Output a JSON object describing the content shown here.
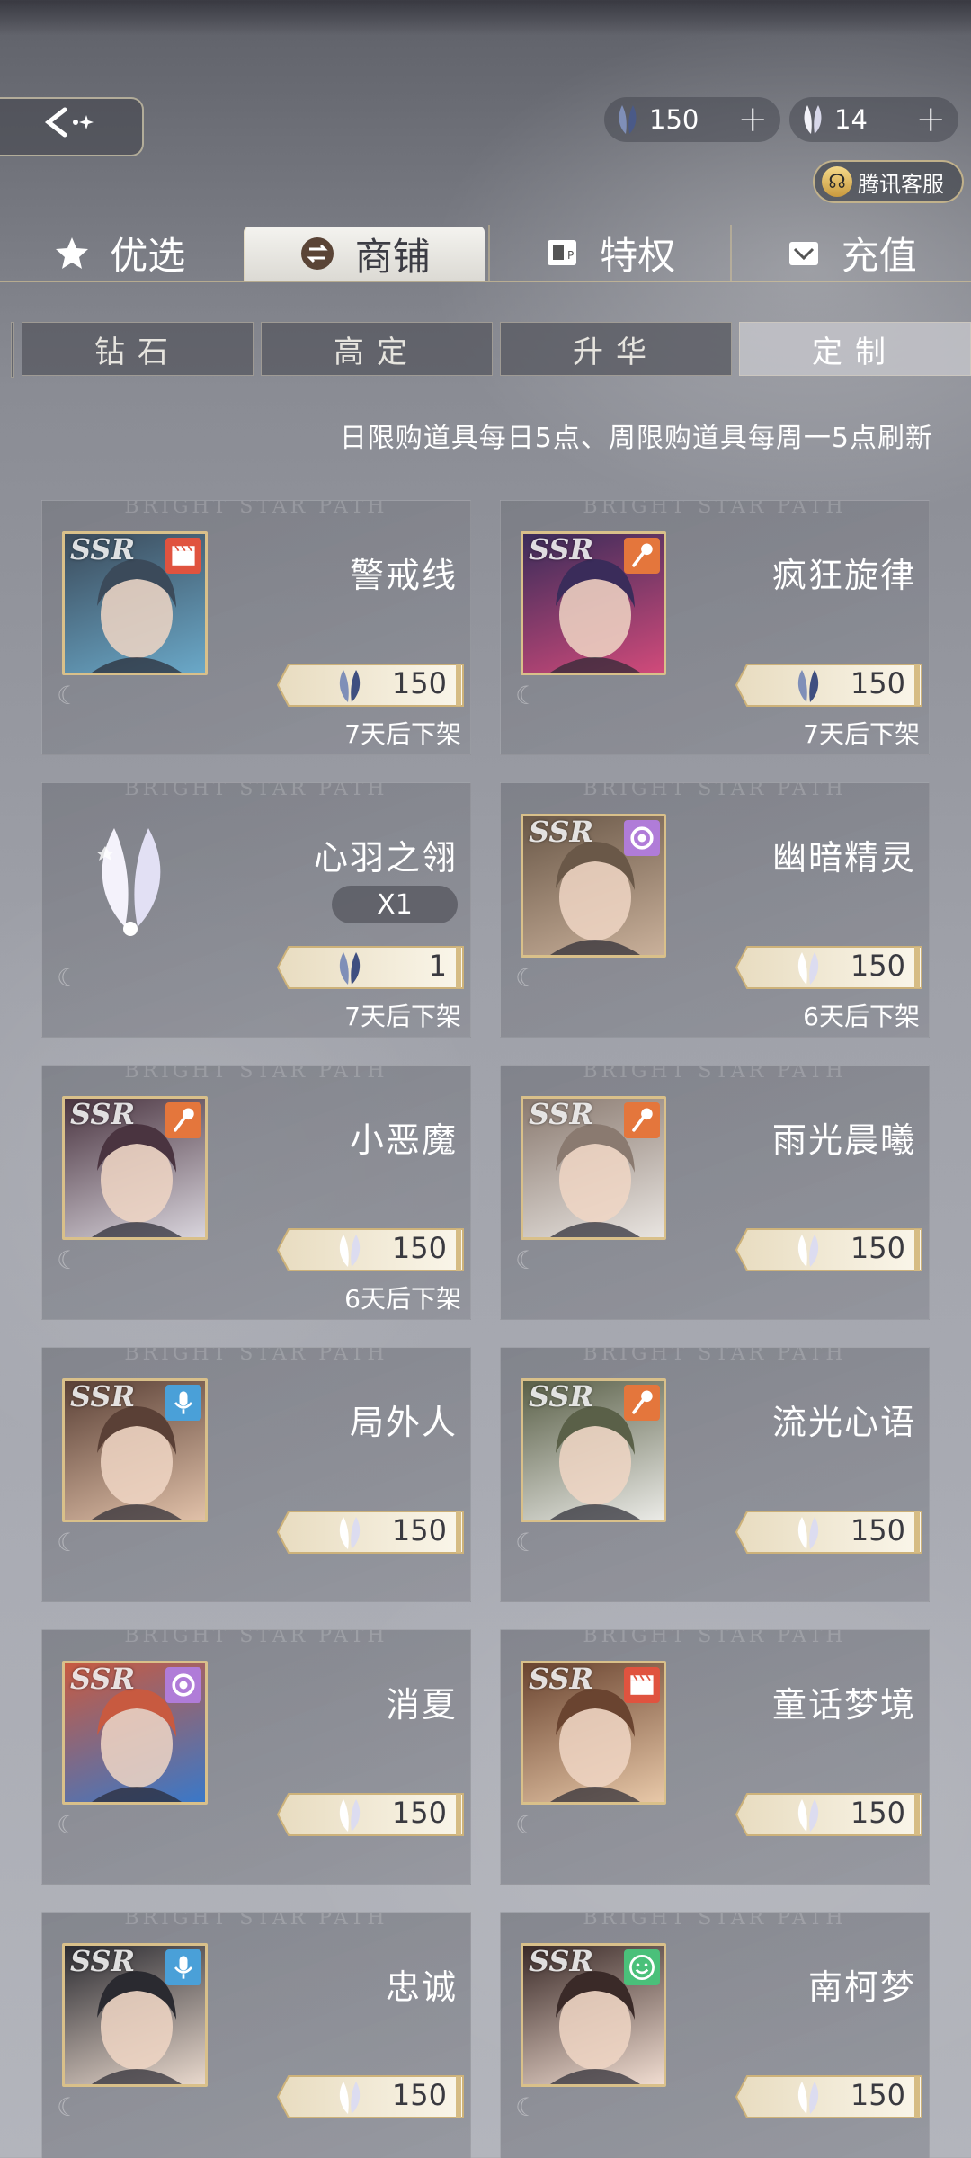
{
  "header": {
    "back_icon": "back-arrow-icon",
    "currencies": [
      {
        "icon": "blue-feather-icon",
        "amount": "150",
        "plus": "+"
      },
      {
        "icon": "white-feather-icon",
        "amount": "14",
        "plus": "+"
      }
    ],
    "service_label": "腾讯客服"
  },
  "main_tabs": [
    {
      "label": "优选",
      "icon": "star-icon",
      "active": false
    },
    {
      "label": "商铺",
      "icon": "exchange-icon",
      "active": true
    },
    {
      "label": "特权",
      "icon": "card-icon",
      "active": false
    },
    {
      "label": "充值",
      "icon": "wallet-icon",
      "active": false
    }
  ],
  "sub_tabs": [
    {
      "label": "钻石",
      "active": false
    },
    {
      "label": "高定",
      "active": false
    },
    {
      "label": "升华",
      "active": false
    },
    {
      "label": "定制",
      "active": true
    }
  ],
  "notice": "日限购道具每日5点、周限购道具每周一5点刷新",
  "watermark": "BRIGHT STAR PATH",
  "products": [
    {
      "name": "警戒线",
      "type": "ssr",
      "role": "clapper-icon",
      "role_color": "#e0533f",
      "palette": [
        "#3b4a5a",
        "#6aa8c8"
      ],
      "price_icon": "blue",
      "price": "150",
      "expiry": "7天后下架"
    },
    {
      "name": "疯狂旋律",
      "type": "ssr",
      "role": "microphone-icon",
      "role_color": "#e4763c",
      "palette": [
        "#3a2c5a",
        "#d04a7a"
      ],
      "price_icon": "blue",
      "price": "150",
      "expiry": "7天后下架"
    },
    {
      "name": "心羽之翎",
      "type": "item",
      "qty": "X1",
      "price_icon": "blue",
      "price": "1",
      "expiry": "7天后下架"
    },
    {
      "name": "幽暗精灵",
      "type": "ssr",
      "role": "camera-icon",
      "role_color": "#b07cd8",
      "palette": [
        "#6a5848",
        "#c9b09a"
      ],
      "price_icon": "white",
      "price": "150",
      "expiry": "6天后下架"
    },
    {
      "name": "小恶魔",
      "type": "ssr",
      "role": "microphone-icon",
      "role_color": "#e4763c",
      "palette": [
        "#4a3440",
        "#d8d4dc"
      ],
      "price_icon": "white",
      "price": "150",
      "expiry": "6天后下架"
    },
    {
      "name": "雨光晨曦",
      "type": "ssr",
      "role": "microphone-icon",
      "role_color": "#e4763c",
      "palette": [
        "#8a7a70",
        "#e8e4e0"
      ],
      "price_icon": "white",
      "price": "150",
      "expiry": ""
    },
    {
      "name": "局外人",
      "type": "ssr",
      "role": "podcast-icon",
      "role_color": "#4aa0d8",
      "palette": [
        "#5a4036",
        "#e0c0a8"
      ],
      "price_icon": "white",
      "price": "150",
      "expiry": ""
    },
    {
      "name": "流光心语",
      "type": "ssr",
      "role": "microphone-icon",
      "role_color": "#e4763c",
      "palette": [
        "#5a6048",
        "#eaeae6"
      ],
      "price_icon": "white",
      "price": "150",
      "expiry": ""
    },
    {
      "name": "消夏",
      "type": "ssr",
      "role": "camera-icon",
      "role_color": "#b07cd8",
      "palette": [
        "#c85a40",
        "#3a78c8"
      ],
      "price_icon": "white",
      "price": "150",
      "expiry": ""
    },
    {
      "name": "童话梦境",
      "type": "ssr",
      "role": "clapper-icon",
      "role_color": "#e0533f",
      "palette": [
        "#6a4430",
        "#e8c8a8"
      ],
      "price_icon": "white",
      "price": "150",
      "expiry": ""
    },
    {
      "name": "忠诚",
      "type": "ssr",
      "role": "podcast-icon",
      "role_color": "#4aa0d8",
      "palette": [
        "#2a2a30",
        "#e8d8cc"
      ],
      "price_icon": "white",
      "price": "150",
      "expiry": ""
    },
    {
      "name": "南柯梦",
      "type": "ssr",
      "role": "smile-icon",
      "role_color": "#4ac07a",
      "palette": [
        "#3a2a28",
        "#f0dcd0"
      ],
      "price_icon": "white",
      "price": "150",
      "expiry": ""
    }
  ],
  "ssr_label": "SSR"
}
